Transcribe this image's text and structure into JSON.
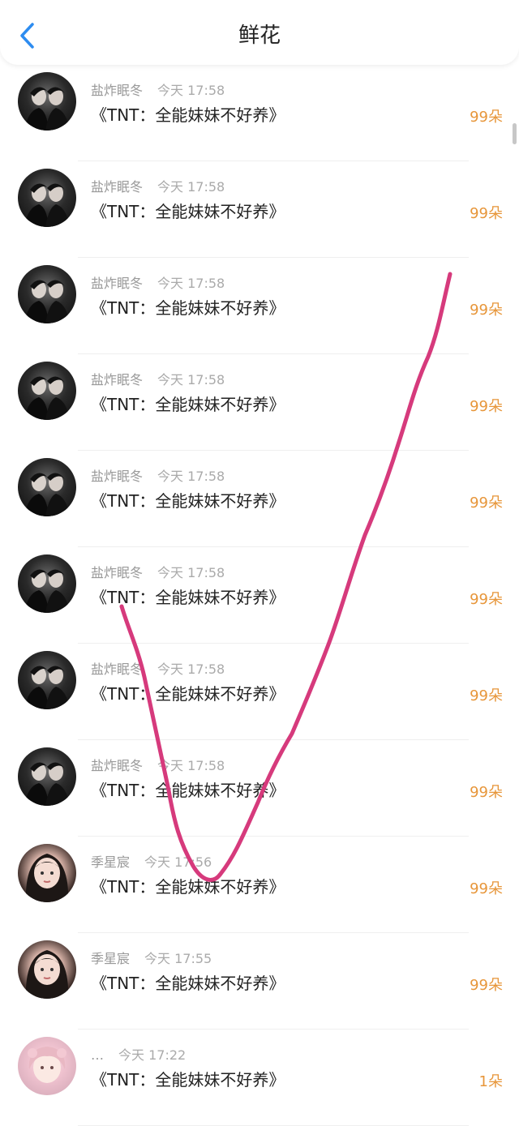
{
  "header": {
    "title": "鲜花",
    "back_icon": "chevron-left-icon",
    "accent": "#2d8cf0"
  },
  "items": [
    {
      "avatar": "dark",
      "name": "盐炸眠冬",
      "time": "今天 17:58",
      "book": "《TNT：全能妹妹不好养》",
      "count": "99朵"
    },
    {
      "avatar": "dark",
      "name": "盐炸眠冬",
      "time": "今天 17:58",
      "book": "《TNT：全能妹妹不好养》",
      "count": "99朵"
    },
    {
      "avatar": "dark",
      "name": "盐炸眠冬",
      "time": "今天 17:58",
      "book": "《TNT：全能妹妹不好养》",
      "count": "99朵"
    },
    {
      "avatar": "dark",
      "name": "盐炸眠冬",
      "time": "今天 17:58",
      "book": "《TNT：全能妹妹不好养》",
      "count": "99朵"
    },
    {
      "avatar": "dark",
      "name": "盐炸眠冬",
      "time": "今天 17:58",
      "book": "《TNT：全能妹妹不好养》",
      "count": "99朵"
    },
    {
      "avatar": "dark",
      "name": "盐炸眠冬",
      "time": "今天 17:58",
      "book": "《TNT：全能妹妹不好养》",
      "count": "99朵"
    },
    {
      "avatar": "dark",
      "name": "盐炸眠冬",
      "time": "今天 17:58",
      "book": "《TNT：全能妹妹不好养》",
      "count": "99朵"
    },
    {
      "avatar": "dark",
      "name": "盐炸眠冬",
      "time": "今天 17:58",
      "book": "《TNT：全能妹妹不好养》",
      "count": "99朵"
    },
    {
      "avatar": "girl",
      "name": "季星宸",
      "time": "今天 17:56",
      "book": "《TNT：全能妹妹不好养》",
      "count": "99朵"
    },
    {
      "avatar": "girl",
      "name": "季星宸",
      "time": "今天 17:55",
      "book": "《TNT：全能妹妹不好养》",
      "count": "99朵"
    },
    {
      "avatar": "pink",
      "name": "…",
      "time": "今天 17:22",
      "book": "《TNT：全能妹妹不好养》",
      "count": "1朵"
    }
  ],
  "colors": {
    "count_text": "#e7963a",
    "scribble": "#d63a7c"
  }
}
